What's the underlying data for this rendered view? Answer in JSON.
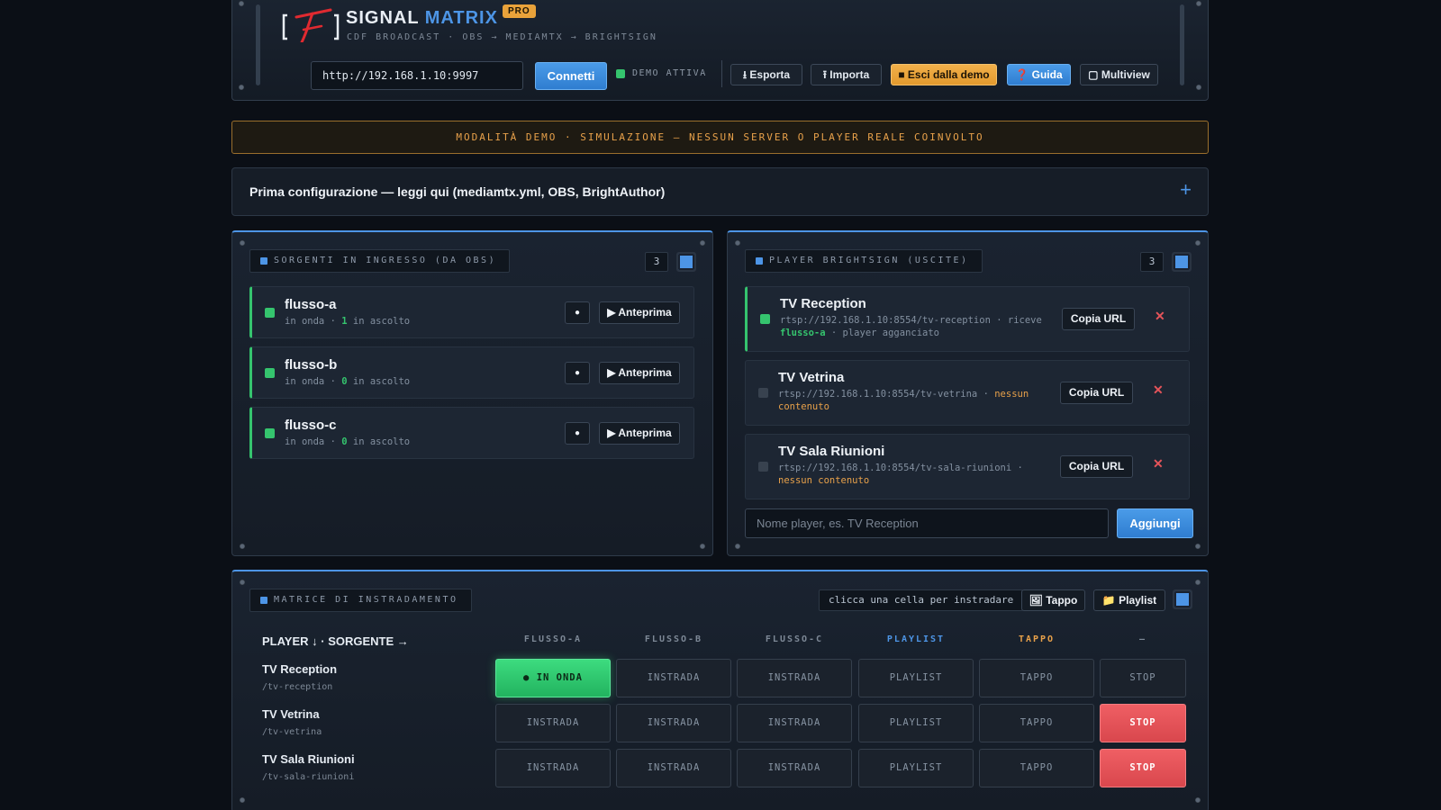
{
  "header": {
    "brand_main": "SIGNAL",
    "brand_accent": "MATRIX",
    "badge": "PRO",
    "subtitle": "CDF BROADCAST · OBS → MEDIAMTX → BRIGHTSIGN",
    "server_url": "http://192.168.1.10:9997",
    "connect": "Connetti",
    "demo_status": "DEMO ATTIVA",
    "buttons": {
      "export": "⭳ Esporta",
      "import": "⭱ Importa",
      "exit_demo": "■ Esci dalla demo",
      "guide": "❓ Guida",
      "multiview": "▢ Multiview"
    }
  },
  "banner": "MODALITÀ DEMO · SIMULAZIONE — NESSUN SERVER O PLAYER REALE COINVOLTO",
  "accordion": {
    "title": "Prima configurazione — leggi qui (mediamtx.yml, OBS, BrightAuthor)",
    "toggle": "+"
  },
  "sources": {
    "title": "SORGENTI IN INGRESSO (DA OBS)",
    "count": "3",
    "items": [
      {
        "name": "flusso-a",
        "status": "in onda",
        "listeners": "1",
        "listeners_suffix": "in ascolto",
        "preview": "▶ Anteprima",
        "rec": "●"
      },
      {
        "name": "flusso-b",
        "status": "in onda",
        "listeners": "0",
        "listeners_suffix": "in ascolto",
        "preview": "▶ Anteprima",
        "rec": "●"
      },
      {
        "name": "flusso-c",
        "status": "in onda",
        "listeners": "0",
        "listeners_suffix": "in ascolto",
        "preview": "▶ Anteprima",
        "rec": "●"
      }
    ]
  },
  "players": {
    "title": "PLAYER BRIGHTSIGN (USCITE)",
    "count": "3",
    "copy_label": "Copia URL",
    "delete": "✕",
    "items": [
      {
        "name": "TV Reception",
        "url": "rtsp://192.168.1.10:8554/tv-reception",
        "sep": " · riceve ",
        "state": "flusso-a",
        "tail": " · player agganciato",
        "active": true
      },
      {
        "name": "TV Vetrina",
        "url": "rtsp://192.168.1.10:8554/tv-vetrina",
        "sep": " · ",
        "state": "nessun contenuto",
        "tail": "",
        "active": false
      },
      {
        "name": "TV Sala Riunioni",
        "url": "rtsp://192.168.1.10:8554/tv-sala-riunioni",
        "sep": " · ",
        "state": "nessun contenuto",
        "tail": "",
        "active": false
      }
    ],
    "input_placeholder": "Nome player, es. TV Reception",
    "add": "Aggiungi"
  },
  "matrix": {
    "title": "MATRICE DI INSTRADAMENTO",
    "hint": "clicca una cella per instradare",
    "tappo_btn": "🖼 Tappo",
    "playlist_btn": "📁 Playlist",
    "corner": "PLAYER ↓ · SORGENTE →",
    "columns": [
      "FLUSSO-A",
      "FLUSSO-B",
      "FLUSSO-C",
      "PLAYLIST",
      "TAPPO",
      "—"
    ],
    "rows": [
      {
        "name": "TV Reception",
        "path": "/tv-reception",
        "cells": [
          "● IN ONDA",
          "INSTRADA",
          "INSTRADA",
          "PLAYLIST",
          "TAPPO",
          "STOP"
        ],
        "active": 0
      },
      {
        "name": "TV Vetrina",
        "path": "/tv-vetrina",
        "cells": [
          "INSTRADA",
          "INSTRADA",
          "INSTRADA",
          "PLAYLIST",
          "TAPPO",
          "STOP"
        ],
        "active": 5
      },
      {
        "name": "TV Sala Riunioni",
        "path": "/tv-sala-riunioni",
        "cells": [
          "INSTRADA",
          "INSTRADA",
          "INSTRADA",
          "PLAYLIST",
          "TAPPO",
          "STOP"
        ],
        "active": 5
      }
    ]
  }
}
